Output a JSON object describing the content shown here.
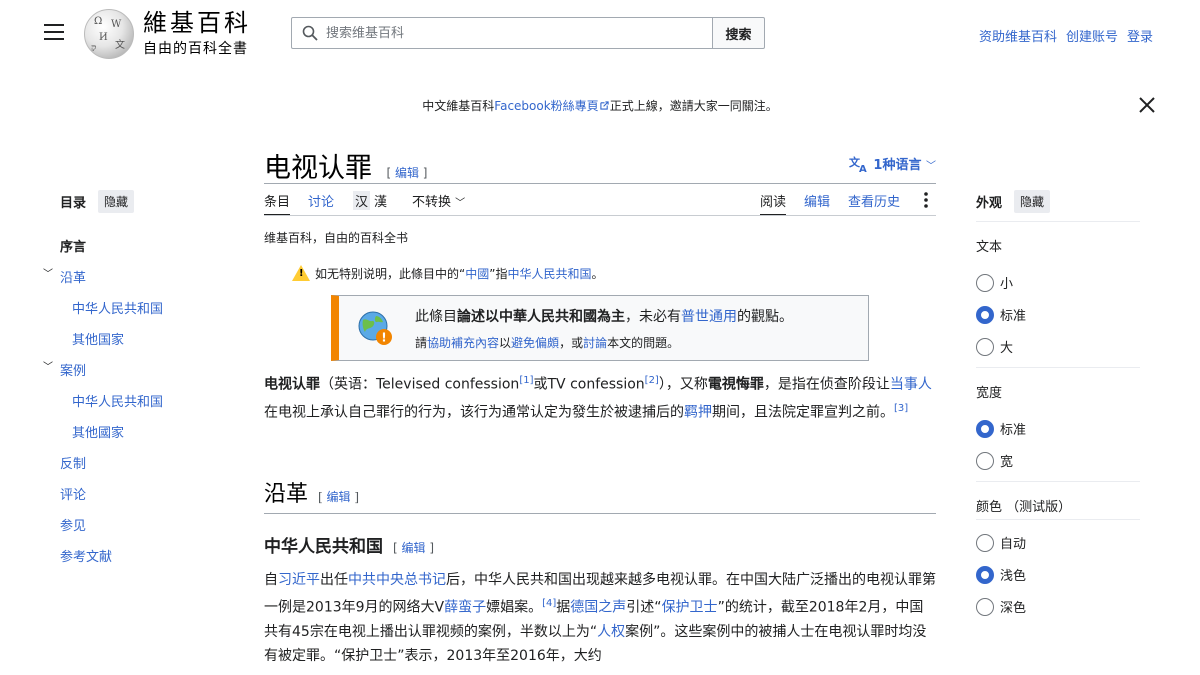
{
  "header": {
    "logo_title": "維基百科",
    "logo_subtitle": "自由的百科全書",
    "search_placeholder": "搜索维基百科",
    "search_button": "搜索",
    "user_links": [
      "资助维基百科",
      "创建账号",
      "登录"
    ]
  },
  "banner": {
    "prefix": "中文維基百科",
    "link": "Facebook粉絲專頁",
    "suffix": "正式上線，邀請大家一同關注。"
  },
  "toc": {
    "title": "目录",
    "hide": "隐藏",
    "items": [
      {
        "label": "序言"
      },
      {
        "label": "沿革"
      },
      {
        "label": "中华人民共和国"
      },
      {
        "label": "其他国家"
      },
      {
        "label": "案例"
      },
      {
        "label": "中华人民共和国"
      },
      {
        "label": "其他國家"
      },
      {
        "label": "反制"
      },
      {
        "label": "评论"
      },
      {
        "label": "参见"
      },
      {
        "label": "参考文献"
      }
    ]
  },
  "article": {
    "title": "电视认罪",
    "edit": "编辑",
    "lang": "1种语言",
    "tabs": {
      "article": "条目",
      "talk": "讨论",
      "han_simplified": "汉",
      "han_traditional": "漢",
      "variant": "不转换",
      "read": "阅读",
      "edit": "编辑",
      "history": "查看历史"
    },
    "subtitle": "维基百科，自由的百科全书",
    "notice": {
      "pre": "如无特别说明，此條目中的“",
      "link1": "中國",
      "mid": "”指",
      "link2": "中华人民共和国",
      "post": "。"
    },
    "ambox": {
      "l1_pre": "此條目",
      "l1_bold": "論述以中華人民共和國為主",
      "l1_mid": "，未必有",
      "l1_link": "普世通用",
      "l1_post": "的觀點。",
      "l2_pre": "請",
      "l2_link1": "協助補充內容",
      "l2_mid1": "以",
      "l2_link2": "避免偏頗",
      "l2_mid2": "，或",
      "l2_link3": "討論",
      "l2_post": "本文的問題。"
    },
    "intro": {
      "bold1": "电视认罪",
      "t1": "（英语：Televised confession",
      "ref1": "[1]",
      "t2": "或TV confession",
      "ref2": "[2]",
      "t3": "），又称",
      "bold2": "電視悔罪",
      "t4": "，是指在侦查阶段让",
      "link1": "当事人",
      "t5": "在电视上承认自己罪行的行为，该行为通常认定为發生於被逮捕后的",
      "link2": "羁押",
      "t6": "期间，且法院定罪宣判之前。",
      "ref3": "[3]"
    },
    "h2": "沿革",
    "h3": "中华人民共和国",
    "body": {
      "t1": "自",
      "link1": "习近平",
      "t2": "出任",
      "link2": "中共中央总书记",
      "t3": "后，中华人民共和国出现越来越多电视认罪。在中国大陆广泛播出的电视认罪第一例是2013年9月的网络大V",
      "link3": "薛蛮子",
      "t4": "嫖娼案。",
      "ref4": "[4]",
      "t5": "据",
      "link4": "德国之声",
      "t6": "引述“",
      "link5": "保护卫士",
      "t7": "”的统计，截至2018年2月，中国共有45宗在电视上播出认罪视频的案例，半数以上为“",
      "link6": "人权",
      "t8": "案例”。这些案例中的被捕人士在电视认罪时均没有被定罪。“保护卫士”表示，2013年至2016年，大约"
    }
  },
  "appearance": {
    "title": "外观",
    "hide": "隐藏",
    "text_label": "文本",
    "text_options": [
      "小",
      "标准",
      "大"
    ],
    "text_selected": "标准",
    "width_label": "宽度",
    "width_options": [
      "标准",
      "宽"
    ],
    "width_selected": "标准",
    "color_label": "颜色 （测试版）",
    "color_options": [
      "自动",
      "浅色",
      "深色"
    ],
    "color_selected": "浅色"
  }
}
